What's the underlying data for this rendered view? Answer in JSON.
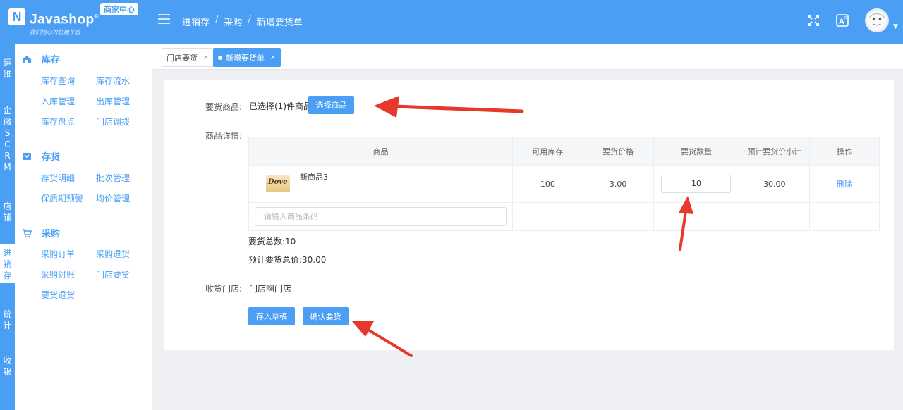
{
  "header": {
    "logo_mark": "N",
    "logo_name": "Javashop",
    "logo_reg": "®",
    "logo_slogan": "我们用心为您建平台",
    "merchant_badge": "商家中心",
    "breadcrumb": [
      "进销存",
      "采购",
      "新增要货单"
    ],
    "breadcrumb_sep": "/"
  },
  "vertical_nav": [
    {
      "label": "运\n维"
    },
    {
      "label": "企\n微\nS\nC\nR\nM"
    },
    {
      "label": "店\n铺"
    },
    {
      "label": "进\n销\n存",
      "active": true
    },
    {
      "label": "统\n计"
    },
    {
      "label": "收\n银"
    }
  ],
  "sidebar": {
    "groups": [
      {
        "title": "库存",
        "icon": "home-icon",
        "links": [
          "库存查询",
          "库存流水",
          "入库管理",
          "出库管理",
          "库存盘点",
          "门店调拨"
        ]
      },
      {
        "title": "存货",
        "icon": "inventory-icon",
        "links": [
          "存货明细",
          "批次管理",
          "保质期预警",
          "均价管理"
        ]
      },
      {
        "title": "采购",
        "icon": "cart-icon",
        "links": [
          "采购订单",
          "采购退货",
          "采购对账",
          "门店要货",
          "要货退货"
        ]
      }
    ]
  },
  "tabs": [
    {
      "label": "门店要货",
      "close": "×",
      "active": false
    },
    {
      "label": "新增要货单",
      "close": "×",
      "active": true
    }
  ],
  "form": {
    "goods_label": "要货商品:",
    "goods_selected": "已选择(1)件商品",
    "select_goods_button": "选择商品",
    "details_label": "商品详情:",
    "table": {
      "columns": [
        "商品",
        "可用库存",
        "要货价格",
        "要货数量",
        "预计要货价小计",
        "操作"
      ],
      "rows": [
        {
          "thumb_brand": "Dove",
          "name": "新商品3",
          "stock": "100",
          "price": "3.00",
          "quantity": "10",
          "subtotal": "30.00",
          "action": "删除"
        }
      ],
      "barcode_placeholder": "请输入商品条码"
    },
    "total_qty_label": "要货总数:",
    "total_qty_value": "10",
    "total_price_label": "预计要货总价:",
    "total_price_value": "30.00",
    "store_label": "收货门店:",
    "store_value": "门店啊门店",
    "save_draft_button": "存入草稿",
    "confirm_button": "确认要货"
  },
  "colors": {
    "primary": "#4a9ff5",
    "annotation_arrow": "#e8382b"
  }
}
